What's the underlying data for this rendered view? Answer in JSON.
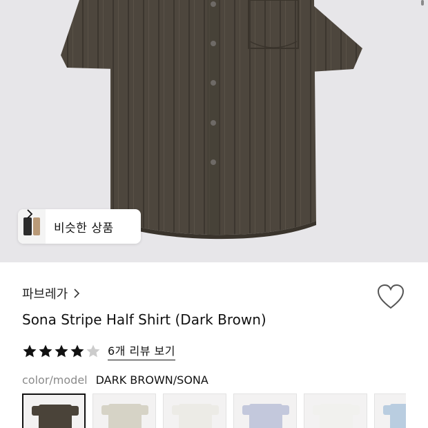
{
  "similar": {
    "label": "비슷한 상품"
  },
  "product": {
    "brand": "파브레가",
    "title": "Sona Stripe Half Shirt (Dark Brown)",
    "rating": 4,
    "max_rating": 5,
    "review_link": "6개 리뷰 보기",
    "color_key": "color/model",
    "color_value": "DARK BROWN/SONA"
  },
  "swatches": [
    {
      "color": "#4a4339",
      "selected": true
    },
    {
      "color": "#d6d3c6",
      "selected": false
    },
    {
      "color": "#ecebe6",
      "selected": false
    },
    {
      "color": "#c3c8dc",
      "selected": false
    },
    {
      "color": "#f1f1ee",
      "selected": false
    },
    {
      "color": "#b9cde0",
      "selected": false
    }
  ],
  "colors": {
    "hero_bg": "#e7e6e9",
    "shirt": "#4d463d",
    "star_filled": "#111111",
    "star_empty": "#cccccc"
  }
}
